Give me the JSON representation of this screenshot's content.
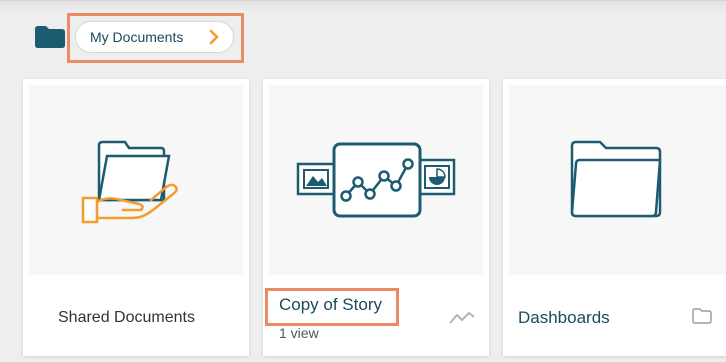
{
  "breadcrumb": {
    "label": "My Documents",
    "root_icon": "folder-icon",
    "chevron_icon": "chevron-right-icon"
  },
  "cards": [
    {
      "title": "Shared Documents",
      "icon": "shared-folder-hand-icon"
    },
    {
      "title": "Copy of Story",
      "subtitle": "1 view",
      "icon": "story-chart-icon",
      "type_icon": "trend-line-icon"
    },
    {
      "title": "Dashboards",
      "icon": "folder-outline-icon",
      "type_icon": "folder-small-icon"
    }
  ],
  "colors": {
    "accent": "#ec8a66",
    "brand_dark": "#1c4a5e",
    "highlight": "#f39c2f"
  }
}
